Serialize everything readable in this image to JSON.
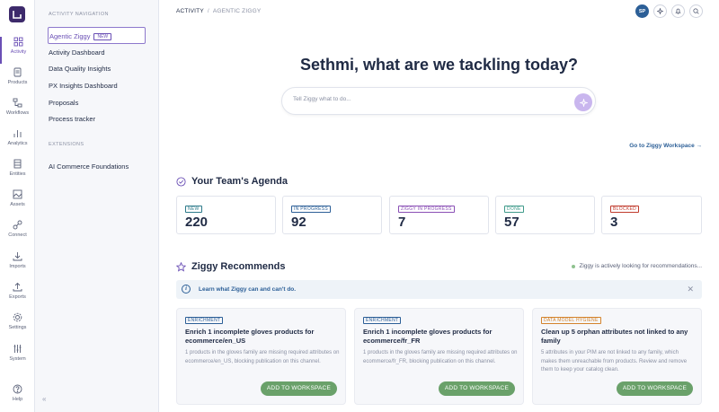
{
  "rail": {
    "items": [
      {
        "label": "Activity",
        "icon": "grid-icon"
      },
      {
        "label": "Products",
        "icon": "products-icon"
      },
      {
        "label": "Workflows",
        "icon": "workflows-icon"
      },
      {
        "label": "Analytics",
        "icon": "analytics-icon"
      },
      {
        "label": "Entities",
        "icon": "entities-icon"
      },
      {
        "label": "Assets",
        "icon": "assets-icon"
      },
      {
        "label": "Connect",
        "icon": "connect-icon"
      },
      {
        "label": "Imports",
        "icon": "imports-icon"
      },
      {
        "label": "Exports",
        "icon": "exports-icon"
      },
      {
        "label": "Settings",
        "icon": "settings-icon"
      },
      {
        "label": "System",
        "icon": "system-icon"
      },
      {
        "label": "Help",
        "icon": "help-icon"
      }
    ]
  },
  "subnav": {
    "section1_title": "ACTIVITY NAVIGATION",
    "items": [
      {
        "label": "Agentic Ziggy",
        "badge": "NEW"
      },
      {
        "label": "Activity Dashboard"
      },
      {
        "label": "Data Quality Insights"
      },
      {
        "label": "PX Insights Dashboard"
      },
      {
        "label": "Proposals"
      },
      {
        "label": "Process tracker"
      }
    ],
    "section2_title": "EXTENSIONS",
    "extensions": [
      {
        "label": "AI Commerce Foundations"
      }
    ],
    "collapse_glyph": "«"
  },
  "header": {
    "breadcrumb": {
      "root": "ACTIVITY",
      "separator": "/",
      "current": "AGENTIC ZIGGY"
    },
    "avatar_initials": "SP"
  },
  "hero": {
    "title": "Sethmi, what are we tackling today?",
    "prompt_placeholder": "Tell Ziggy what to do...",
    "workspace_link": "Go to Ziggy Workspace →"
  },
  "agenda": {
    "title": "Your Team's Agenda",
    "stats": [
      {
        "label": "NEW",
        "value": "220",
        "color": "#2c7a8a"
      },
      {
        "label": "IN PROGRESS",
        "value": "92",
        "color": "#2c5f97"
      },
      {
        "label": "ZIGGY IN PROGRESS",
        "value": "7",
        "color": "#8a4fb5"
      },
      {
        "label": "DONE",
        "value": "57",
        "color": "#3f9a8a"
      },
      {
        "label": "BLOCKED",
        "value": "3",
        "color": "#c0392b"
      }
    ]
  },
  "recommend": {
    "title": "Ziggy Recommends",
    "status": "Ziggy is actively looking for recommendations...",
    "info_link": "Learn what Ziggy can and can't do.",
    "close_glyph": "✕",
    "cards": [
      {
        "tag": "ENRICHMENT",
        "tag_color": "#2c5f97",
        "title": "Enrich 1 incomplete gloves products for ecommerce/en_US",
        "desc": "1 products in the gloves family are missing required attributes on ecommerce/en_US, blocking publication on this channel.",
        "button": "ADD TO WORKSPACE"
      },
      {
        "tag": "ENRICHMENT",
        "tag_color": "#2c5f97",
        "title": "Enrich 1 incomplete gloves products for ecommerce/fr_FR",
        "desc": "1 products in the gloves family are missing required attributes on ecommerce/fr_FR, blocking publication on this channel.",
        "button": "ADD TO WORKSPACE"
      },
      {
        "tag": "DATA MODEL HYGIENE",
        "tag_color": "#d4832c",
        "title": "Clean up 5 orphan attributes not linked to any family",
        "desc": "5 attributes in your PIM are not linked to any family, which makes them unreachable from products. Review and remove them to keep your catalog clean.",
        "button": "ADD TO WORKSPACE"
      }
    ]
  },
  "colors": {
    "brand": "#3d2a6b",
    "accent": "#6a4fb5",
    "link": "#2c5f97",
    "action_green": "#6aa16a"
  }
}
